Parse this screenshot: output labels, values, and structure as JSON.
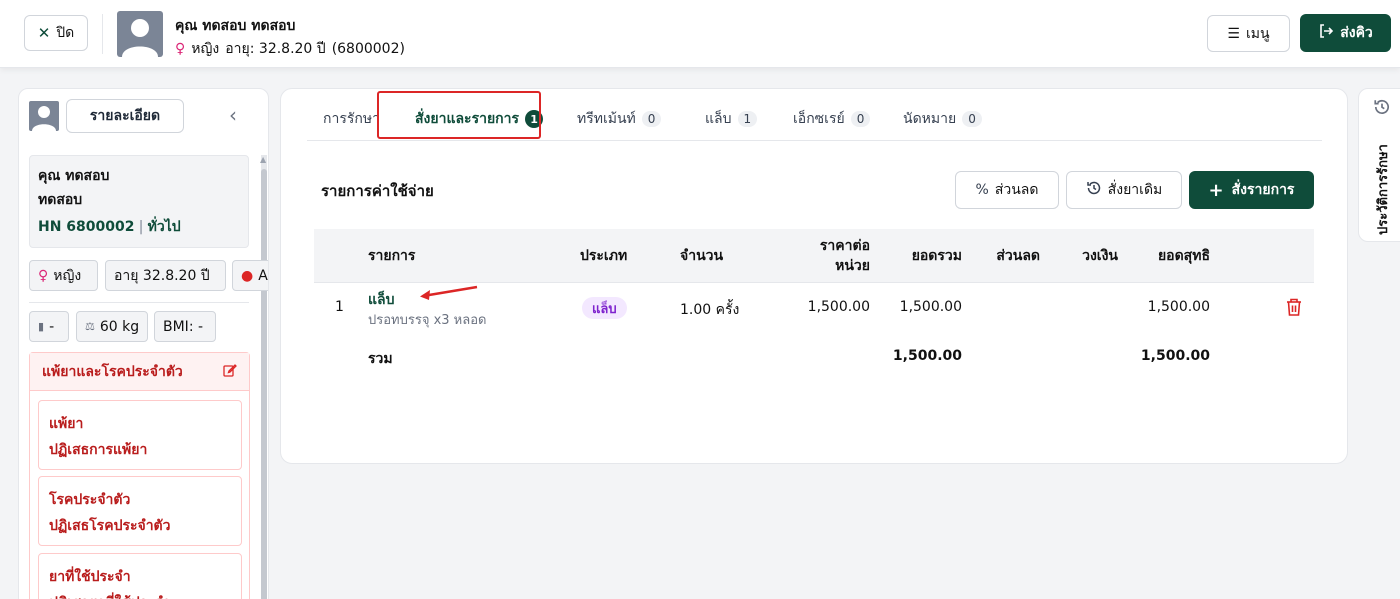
{
  "header": {
    "close_label": "ปิด",
    "patient_name": "คุณ ทดสอบ ทดสอบ",
    "gender": "หญิง",
    "age_text": "อายุ: 32.8.20 ปี",
    "patient_code": "(6800002)",
    "menu_label": "เมนู",
    "send_queue_label": "ส่งคิว"
  },
  "left_panel": {
    "detail_button": "รายละเอียด",
    "patient": {
      "line1": "คุณ ทดสอบ",
      "line2": "ทดสอบ",
      "hn": "HN 6800002",
      "group": "ทั่วไป"
    },
    "chips": {
      "gender": "หญิง",
      "age": "อายุ 32.8.20 ปี",
      "blood": "A",
      "height": "-",
      "weight": "60 kg",
      "bmi": "BMI: -"
    },
    "allergy_section": {
      "title": "แพ้ยาและโรคประจำตัว",
      "items": [
        {
          "title": "แพ้ยา",
          "value": "ปฏิเสธการแพ้ยา"
        },
        {
          "title": "โรคประจำตัว",
          "value": "ปฏิเสธโรคประจำตัว"
        },
        {
          "title": "ยาที่ใช้ประจำ",
          "value": "ปฏิเสธยาที่ใช้ประจำ"
        }
      ]
    }
  },
  "tabs": [
    {
      "label": "การรักษา",
      "count": null
    },
    {
      "label": "สั่งยาและรายการ",
      "count": "1"
    },
    {
      "label": "ทรีทเม้นท์",
      "count": "0"
    },
    {
      "label": "แล็บ",
      "count": "1"
    },
    {
      "label": "เอ็กซเรย์",
      "count": "0"
    },
    {
      "label": "นัดหมาย",
      "count": "0"
    }
  ],
  "expense": {
    "title": "รายการค่าใช้จ่าย",
    "discount_button": "ส่วนลด",
    "previous_order_button": "สั่งยาเดิม",
    "add_order_button": "สั่งรายการ",
    "columns": {
      "item": "รายการ",
      "type": "ประเภท",
      "qty": "จำนวน",
      "unit_price_1": "ราคาต่อ",
      "unit_price_2": "หน่วย",
      "total": "ยอดรวม",
      "discount": "ส่วนลด",
      "limit": "วงเงิน",
      "net": "ยอดสุทธิ"
    },
    "rows": [
      {
        "no": "1",
        "item": "แล็บ",
        "item_detail": "ปรอทบรรจุ x3 หลอด",
        "type": "แล็บ",
        "qty": "1.00 ครั้ง",
        "unit_price": "1,500.00",
        "total": "1,500.00",
        "discount": "",
        "limit": "",
        "net": "1,500.00"
      }
    ],
    "summary": {
      "label": "รวม",
      "total": "1,500.00",
      "net": "1,500.00"
    }
  },
  "right_sidebar": {
    "label": "ประวัติการรักษา"
  },
  "colors": {
    "brand": "#0f4c3a",
    "danger": "#dc2626",
    "lab_badge": "#7e22ce"
  }
}
